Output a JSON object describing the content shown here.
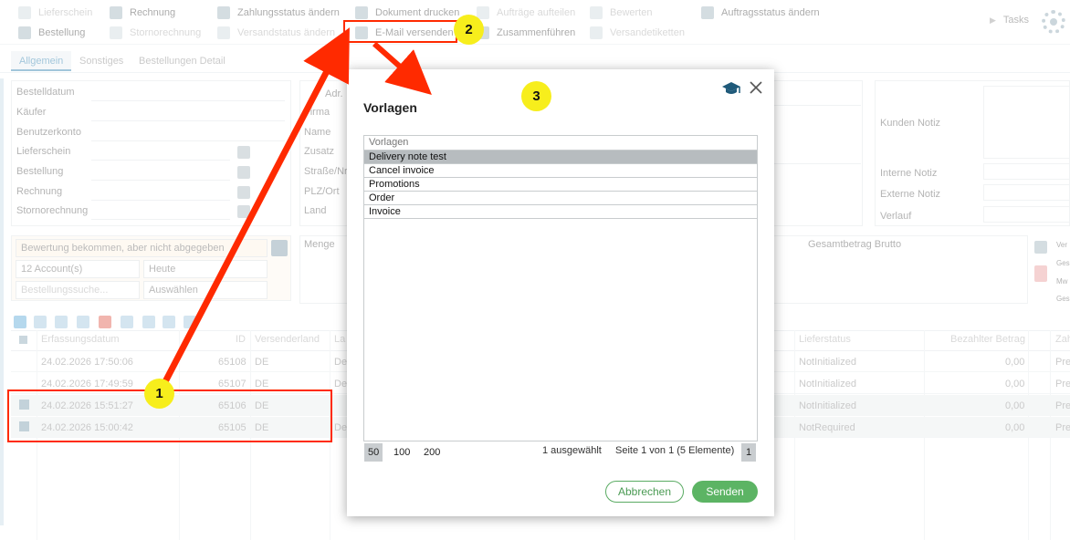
{
  "toolbar": {
    "row1": [
      {
        "label": "Lieferschein",
        "icon": "document-icon",
        "dim": true
      },
      {
        "label": "Rechnung",
        "icon": "document-icon",
        "dim": false
      },
      {
        "label": "Zahlungsstatus ändern",
        "icon": "euro-icon",
        "dim": false
      },
      {
        "label": "Dokument drucken",
        "icon": "printer-icon",
        "dim": false
      },
      {
        "label": "Aufträge aufteilen",
        "icon": "split-icon",
        "dim": true
      },
      {
        "label": "Bewerten",
        "icon": "star-icon",
        "dim": true
      },
      {
        "label": "Auftragsstatus ändern",
        "icon": "status-icon",
        "dim": false
      }
    ],
    "row2": [
      {
        "label": "Bestellung",
        "icon": "document-icon",
        "dim": false
      },
      {
        "label": "Stornorechnung",
        "icon": "document-icon",
        "dim": true
      },
      {
        "label": "Versandstatus ändern",
        "icon": "box-icon",
        "dim": true
      },
      {
        "label": "E-Mail versenden",
        "icon": "at-icon",
        "dim": false
      },
      {
        "label": "Zusammenführen",
        "icon": "merge-icon",
        "dim": false
      },
      {
        "label": "Versandetiketten",
        "icon": "label-icon",
        "dim": true
      }
    ],
    "tasks_label": "Tasks"
  },
  "tabs": [
    "Allgemein",
    "Sonstiges",
    "Bestellungen Detail"
  ],
  "form_left": [
    "Bestelldatum",
    "Käufer",
    "Benutzerkonto",
    "Lieferschein",
    "Bestellung",
    "Rechnung",
    "Stornorechnung"
  ],
  "form_mid": [
    "Adr.",
    "Firma",
    "Name",
    "Zusatz",
    "Straße/Nr",
    "PLZ/Ort",
    "Land"
  ],
  "form_right": [
    "Kunden Notiz",
    "Interne Notiz",
    "Externe Notiz",
    "Verlauf"
  ],
  "filters": {
    "rating": "Bewertung bekommen, aber nicht abgegeben",
    "accounts": "12 Account(s)",
    "date": "Heute",
    "search_placeholder": "Bestellungssuche...",
    "select": "Auswählen"
  },
  "summary": {
    "menge": "Menge",
    "gesamt": "Gesamtbetrag Brutto",
    "side": [
      "Ver",
      "Ges",
      "Mw",
      "Ges"
    ]
  },
  "grid": {
    "headers": [
      "Erfassungsdatum",
      "ID",
      "Versenderland",
      "La",
      "Lieferstatus",
      "Bezahlter Betrag",
      "Zah"
    ],
    "rows": [
      {
        "date": "24.02.2026 17:50:06",
        "id": "65108",
        "land": "DE",
        "la": "Def",
        "status": "NotInitialized",
        "paid": "0,00",
        "zah": "Pre",
        "checked": false
      },
      {
        "date": "24.02.2026 17:49:59",
        "id": "65107",
        "land": "DE",
        "la": "Def",
        "status": "NotInitialized",
        "paid": "0,00",
        "zah": "Pre",
        "checked": false
      },
      {
        "date": "24.02.2026 15:51:27",
        "id": "65106",
        "land": "DE",
        "la": "",
        "status": "NotInitialized",
        "paid": "0,00",
        "zah": "Pre",
        "checked": true
      },
      {
        "date": "24.02.2026 15:00:42",
        "id": "65105",
        "land": "DE",
        "la": "Def",
        "status": "NotRequired",
        "paid": "0,00",
        "zah": "Pre",
        "checked": true
      }
    ]
  },
  "modal": {
    "title": "Vorlagen",
    "list_header": "Vorlagen",
    "items": [
      "Delivery note test",
      "Cancel invoice",
      "Promotions",
      "Order",
      "Invoice"
    ],
    "selected_index": 0,
    "page_sizes": [
      "50",
      "100",
      "200"
    ],
    "selected_count": "1 ausgewählt",
    "page_info": "Seite 1 von 1 (5 Elemente)",
    "page_number": "1",
    "cancel_label": "Abbrechen",
    "send_label": "Senden"
  },
  "annotations": {
    "badge1": "1",
    "badge2": "2",
    "badge3": "3",
    "color": "#ff2a00",
    "badge_color": "#f7ee1c"
  },
  "colors": {
    "accent": "#2f7fae",
    "send": "#5cb464",
    "selected": "#b7bcbf"
  }
}
